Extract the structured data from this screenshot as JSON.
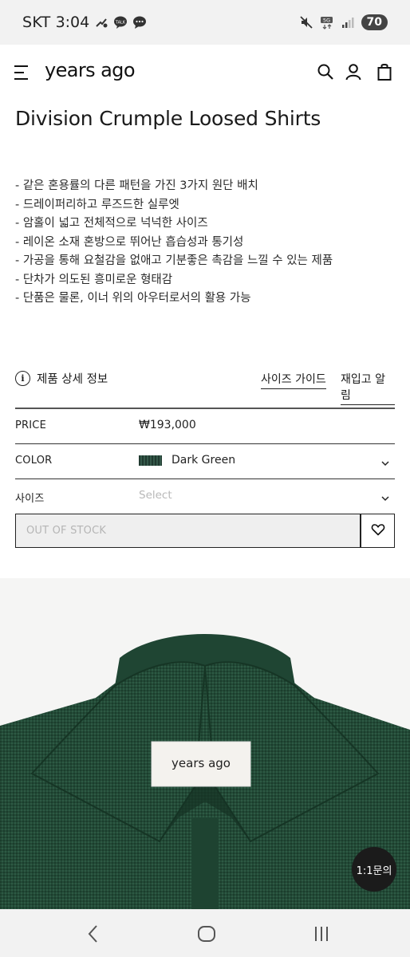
{
  "status_bar": {
    "carrier": "SKT",
    "time": "3:04",
    "network": "5G",
    "battery": "70"
  },
  "header": {
    "logo": "years ago",
    "icons": [
      "menu-icon",
      "search-icon",
      "account-icon",
      "bag-icon"
    ]
  },
  "product": {
    "title": "Division Crumple Loosed Shirts",
    "description": [
      "- 같은 혼용률의 다른 패턴을 가진 3가지 원단 배치",
      "- 드레이퍼리하고 루즈드한 실루엣",
      "- 암홀이 넓고 전체적으로 넉넉한 사이즈",
      "- 레이온 소재 혼방으로 뛰어난 흡습성과 통기성",
      "- 가공을 통해 요철감을 없애고 기분좋은 촉감을 느낄 수 있는 제품",
      "- 단차가 의도된 흥미로운 형태감",
      "- 단품은 물론, 이너 위의 아우터로서의 활용 가능"
    ]
  },
  "info_row": {
    "detail_label": "제품 상세 정보",
    "size_guide": "사이즈 가이드",
    "restock_alert": "재입고 알림"
  },
  "options": {
    "price_label": "PRICE",
    "price_value": "₩193,000",
    "color_label": "COLOR",
    "color_value": "Dark Green",
    "color_swatch": "#2b4a3e",
    "size_label": "사이즈",
    "size_placeholder": "Select"
  },
  "purchase": {
    "status": "OUT OF STOCK",
    "wishlist_icon": "heart-icon"
  },
  "image": {
    "label_text": "years ago"
  },
  "chat_button": "1:1문의",
  "nav": [
    "back-icon",
    "home-icon",
    "recents-icon"
  ]
}
